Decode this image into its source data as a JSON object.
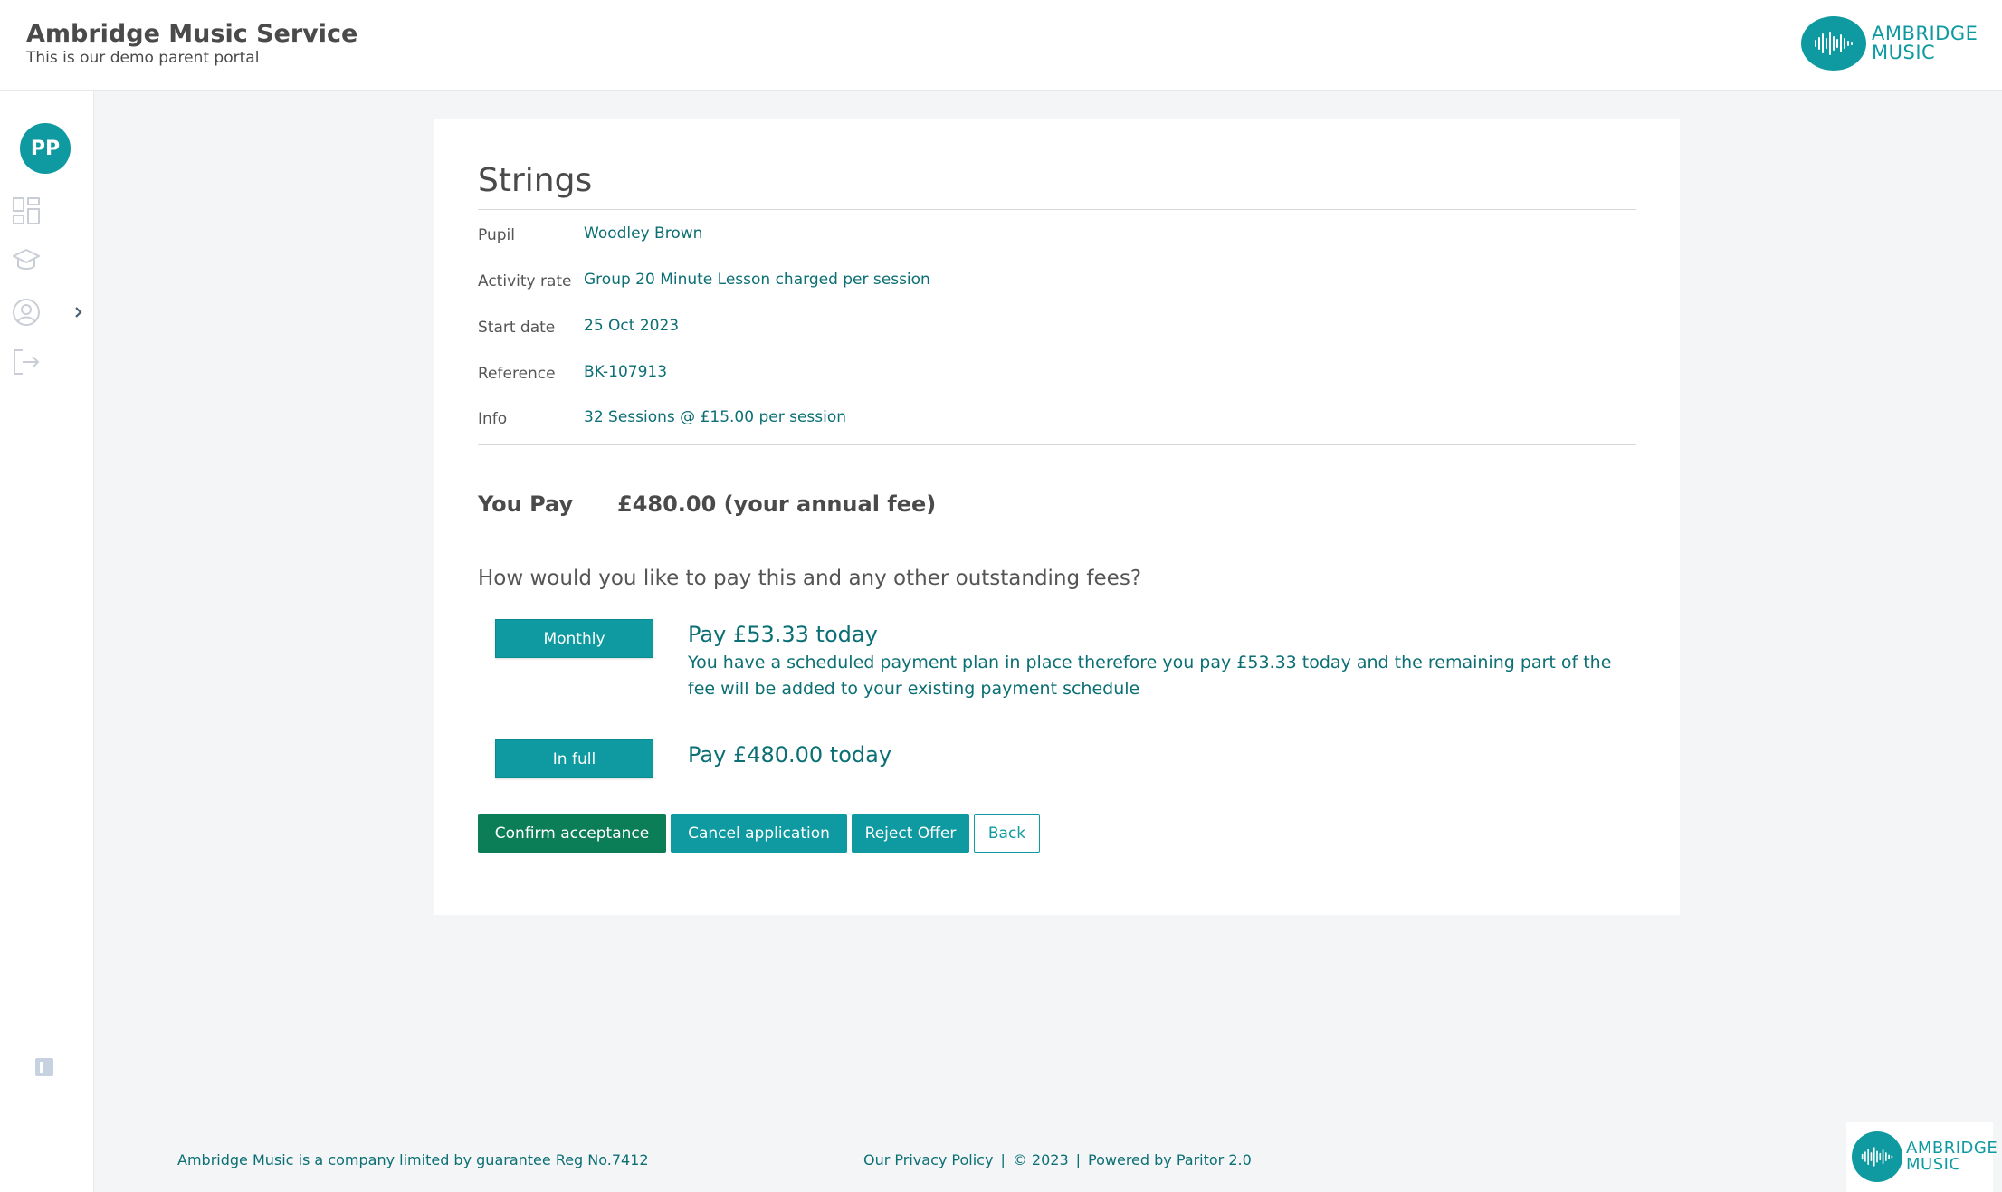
{
  "header": {
    "title": "Ambridge Music Service",
    "subtitle": "This is our demo parent portal",
    "logo_line1": "AMBRIDGE",
    "logo_line2": "MUSIC"
  },
  "sidebar": {
    "avatar_initials": "PP",
    "icons": [
      "dashboard-icon",
      "graduation-cap-icon",
      "user-circle-icon",
      "logout-icon"
    ]
  },
  "card": {
    "title": "Strings",
    "details": [
      {
        "label": "Pupil",
        "value": "Woodley Brown"
      },
      {
        "label": "Activity rate",
        "value": "Group 20 Minute Lesson charged per session"
      },
      {
        "label": "Start date",
        "value": "25 Oct 2023"
      },
      {
        "label": "Reference",
        "value": "BK-107913"
      },
      {
        "label": "Info",
        "value": "32 Sessions @ £15.00 per session"
      }
    ],
    "you_pay_label": "You Pay",
    "you_pay_amount": "£480.00 (your annual fee)",
    "question": "How would you like to pay this and any other outstanding fees?",
    "options": [
      {
        "button": "Monthly",
        "title": "Pay £53.33 today",
        "description": "You have a scheduled payment plan in place therefore you pay £53.33 today and the remaining part of the fee will be added to your existing payment schedule"
      },
      {
        "button": "In full",
        "title": "Pay £480.00 today",
        "description": ""
      }
    ],
    "actions": {
      "confirm": "Confirm acceptance",
      "cancel": "Cancel application",
      "reject": "Reject Offer",
      "back": "Back"
    }
  },
  "footer": {
    "company": "Ambridge Music is a company limited by guarantee Reg No.7412",
    "privacy": "Our Privacy Policy",
    "separator": "|",
    "copyright": "© 2023",
    "powered": "Powered by Paritor 2.0",
    "logo_line1": "AMBRIDGE",
    "logo_line2": "MUSIC"
  },
  "colors": {
    "accent": "#0e9aa0",
    "confirm": "#0b7d57",
    "text_link": "#0b6f74",
    "background": "#f4f5f7"
  }
}
